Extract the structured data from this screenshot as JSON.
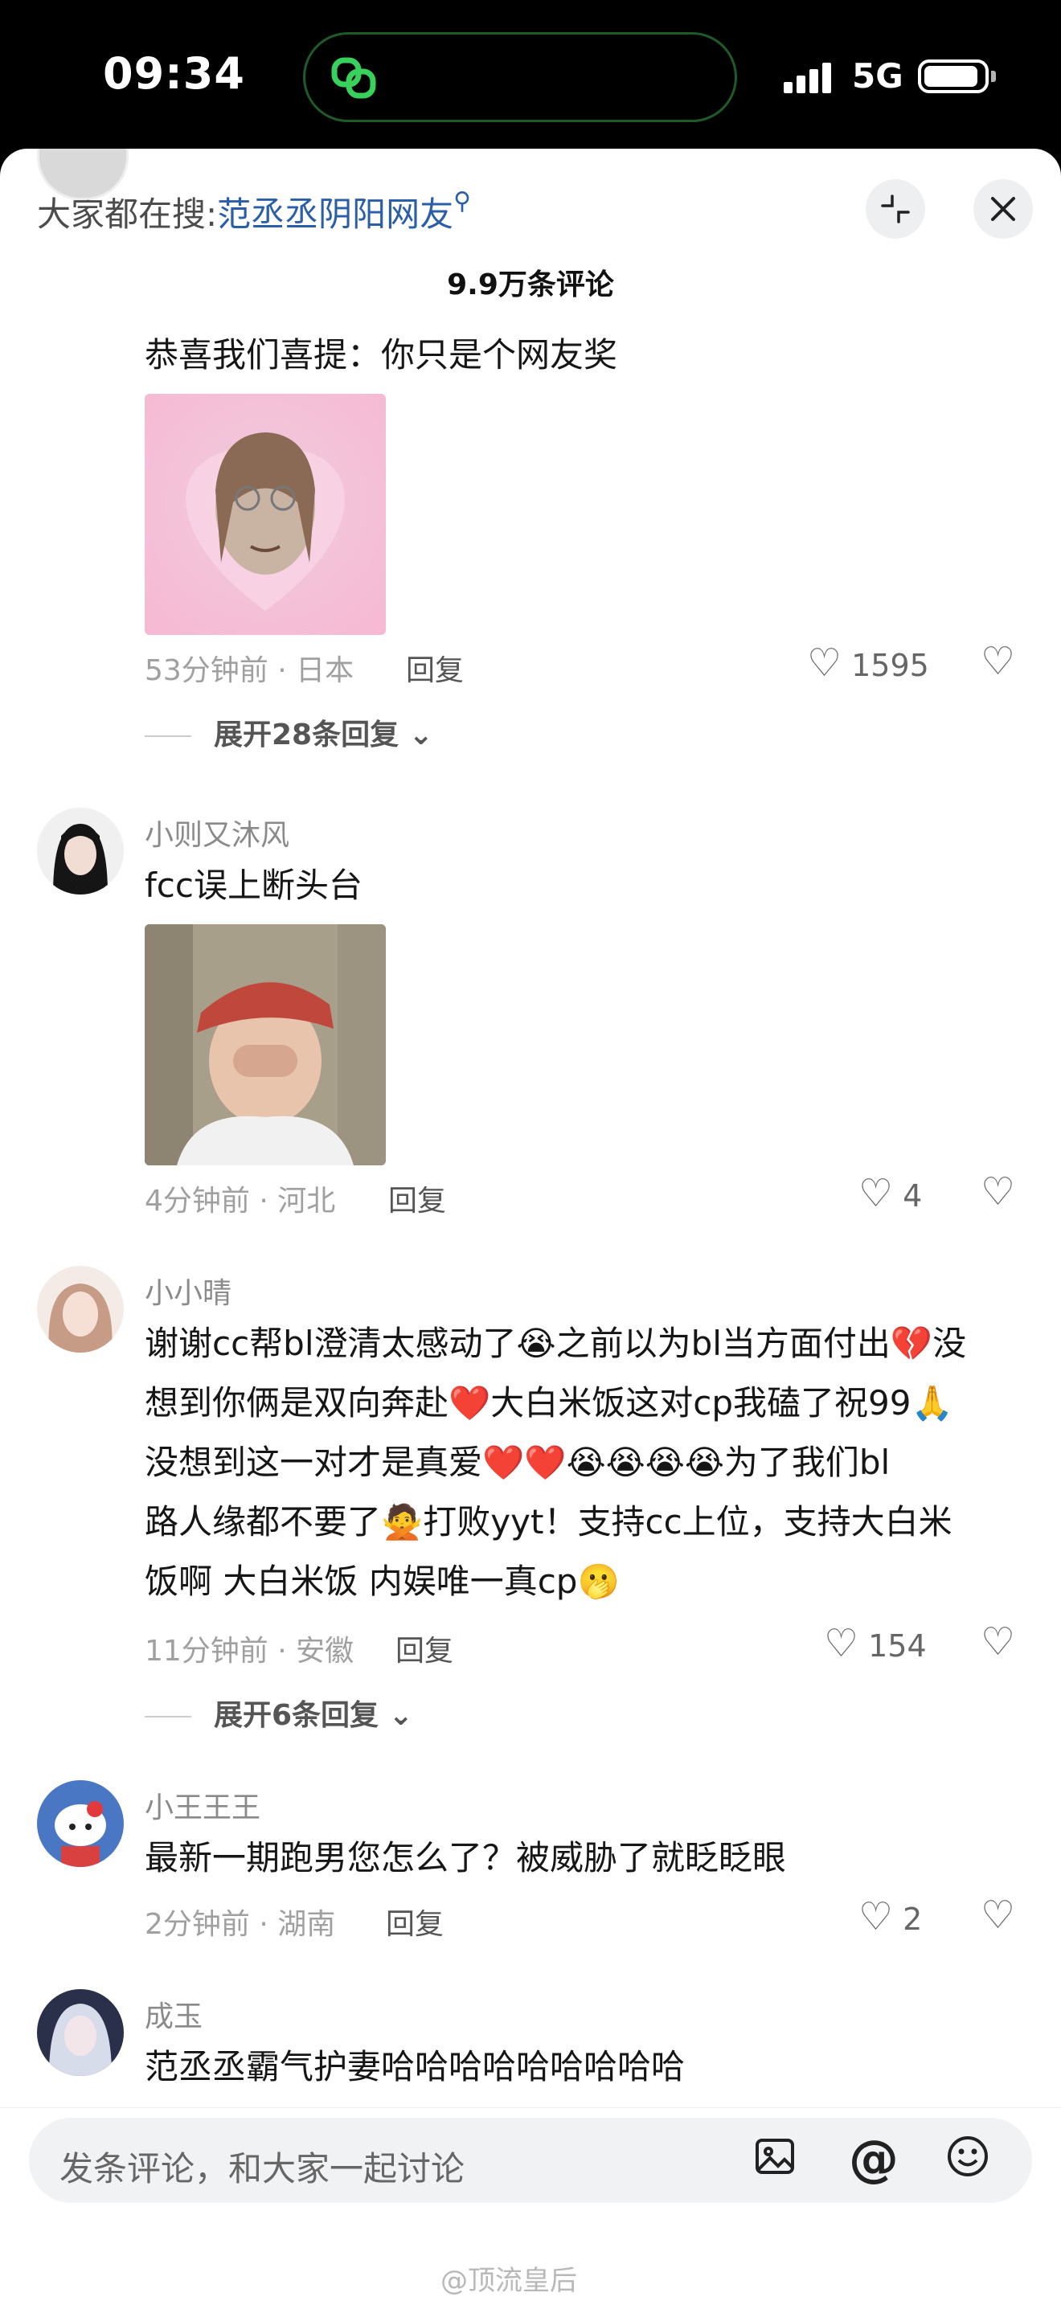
{
  "status_bar": {
    "time": "09:34",
    "network": "5G"
  },
  "header": {
    "search_prefix": "大家都在搜:",
    "search_keyword": "范丞丞阴阳网友",
    "search_icon": "search-icon",
    "comment_count": "9.9万条评论"
  },
  "comments": [
    {
      "text": "恭喜我们喜提：你只是个网友奖",
      "meta": "53分钟前 · 日本",
      "reply": "回复",
      "likes": "1595",
      "expand": "展开28条回复"
    },
    {
      "username": "小则又沐风",
      "text": "fcc误上断头台",
      "meta": "4分钟前 · 河北",
      "reply": "回复",
      "likes": "4"
    },
    {
      "username": "小小晴",
      "lines": [
        "谢谢cc帮bl澄清太感动了😭之前以为bl当方面付出💔没",
        "想到你俩是双向奔赴❤️大白米饭这对cp我磕了祝99🙏",
        "没想到这一对才是真爱❤️❤️😭😭😭😭为了我们bl",
        "路人缘都不要了🙅打败yyt！支持cc上位，支持大白米",
        "饭啊 大白米饭 内娱唯一真cp🫢"
      ],
      "meta": "11分钟前 · 安徽",
      "reply": "回复",
      "likes": "154",
      "expand": "展开6条回复"
    },
    {
      "username": "小王王王",
      "text": "最新一期跑男您怎么了？被威胁了就眨眨眼",
      "meta": "2分钟前 · 湖南",
      "reply": "回复",
      "likes": "2"
    },
    {
      "username": "成玉",
      "text": "范丞丞霸气护妻哈哈哈哈哈哈哈哈哈"
    }
  ],
  "input": {
    "placeholder": "发条评论，和大家一起讨论"
  },
  "watermark": "@顶流皇后",
  "colors": {
    "accent": "#2b5ea8",
    "island_border": "#1e5b28"
  }
}
